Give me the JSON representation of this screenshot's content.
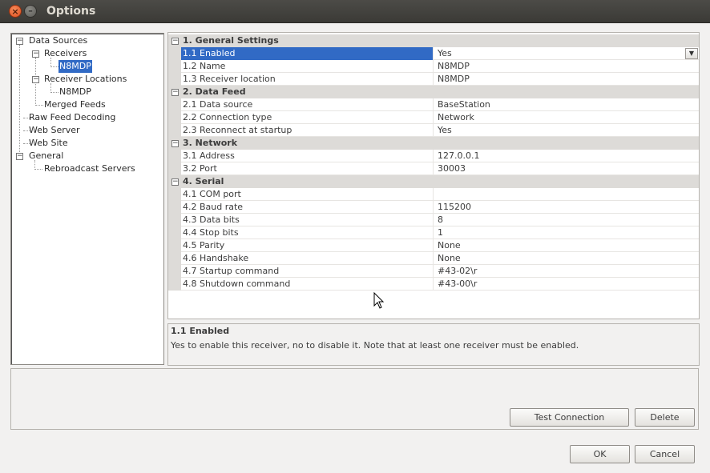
{
  "window": {
    "title": "Options"
  },
  "tree": {
    "data_sources": "Data Sources",
    "receivers": "Receivers",
    "receiver_n8mdp": "N8MDP",
    "receiver_locations": "Receiver Locations",
    "location_n8mdp": "N8MDP",
    "merged_feeds": "Merged Feeds",
    "raw_feed_decoding": "Raw Feed Decoding",
    "web_server": "Web Server",
    "web_site": "Web Site",
    "general": "General",
    "rebroadcast_servers": "Rebroadcast Servers"
  },
  "grid": {
    "categories": {
      "general": "1. General Settings",
      "feed": "2. Data Feed",
      "network": "3. Network",
      "serial": "4. Serial"
    },
    "rows": [
      {
        "name": "1.1 Enabled",
        "value": "Yes"
      },
      {
        "name": "1.2 Name",
        "value": "N8MDP"
      },
      {
        "name": "1.3 Receiver location",
        "value": "N8MDP"
      },
      {
        "name": "2.1 Data source",
        "value": "BaseStation"
      },
      {
        "name": "2.2 Connection type",
        "value": "Network"
      },
      {
        "name": "2.3 Reconnect at startup",
        "value": "Yes"
      },
      {
        "name": "3.1 Address",
        "value": "127.0.0.1"
      },
      {
        "name": "3.2 Port",
        "value": "30003"
      },
      {
        "name": "4.1 COM port",
        "value": ""
      },
      {
        "name": "4.2 Baud rate",
        "value": "115200"
      },
      {
        "name": "4.3 Data bits",
        "value": "8"
      },
      {
        "name": "4.4 Stop bits",
        "value": "1"
      },
      {
        "name": "4.5 Parity",
        "value": "None"
      },
      {
        "name": "4.6 Handshake",
        "value": "None"
      },
      {
        "name": "4.7 Startup command",
        "value": "#43-02\\r"
      },
      {
        "name": "4.8 Shutdown command",
        "value": "#43-00\\r"
      }
    ]
  },
  "description": {
    "title": "1.1 Enabled",
    "text": "Yes to enable this receiver, no to disable it. Note that at least one receiver must be enabled."
  },
  "buttons": {
    "test_connection": "Test Connection",
    "delete": "Delete",
    "ok": "OK",
    "cancel": "Cancel"
  },
  "colors": {
    "selection": "#316ac5",
    "titlebar": "#3b3a36",
    "close": "#e0501e"
  }
}
